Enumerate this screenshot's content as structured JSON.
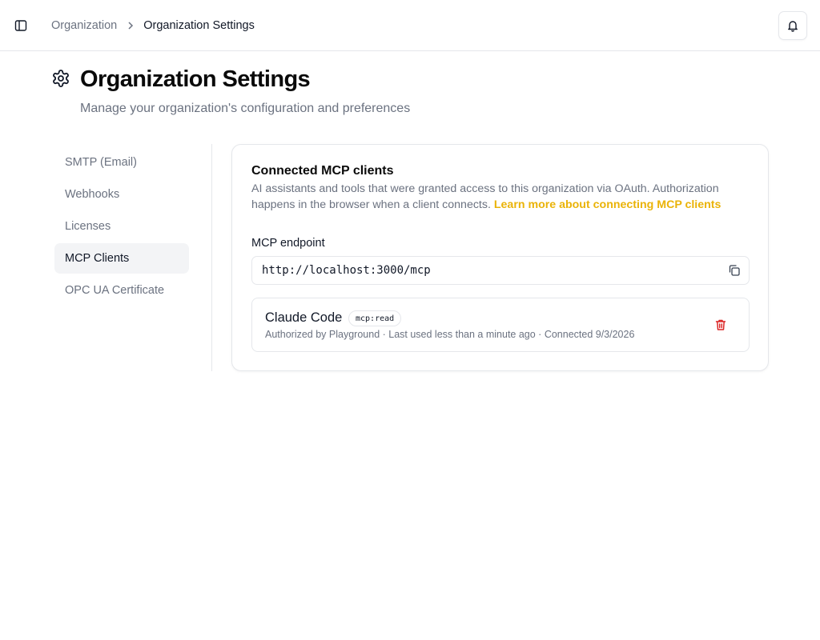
{
  "header": {
    "breadcrumb": {
      "parent": "Organization",
      "current": "Organization Settings"
    },
    "icons": {
      "sidebar_toggle": "sidebar-panel-icon",
      "separator": "chevron-right-icon",
      "notifications": "bell-icon"
    }
  },
  "page": {
    "title": "Organization Settings",
    "subtitle": "Manage your organization's configuration and preferences",
    "icon": "gear-icon"
  },
  "settings_nav": {
    "items": [
      {
        "label": "SMTP (Email)",
        "active": false
      },
      {
        "label": "Webhooks",
        "active": false
      },
      {
        "label": "Licenses",
        "active": false
      },
      {
        "label": "MCP Clients",
        "active": true
      },
      {
        "label": "OPC UA Certificate",
        "active": false
      }
    ]
  },
  "mcp_card": {
    "title": "Connected MCP clients",
    "description": "AI assistants and tools that were granted access to this organization via OAuth. Authorization happens in the browser when a client connects.",
    "learn_more": "Learn more about connecting MCP clients",
    "endpoint_label": "MCP endpoint",
    "endpoint_value": "http://localhost:3000/mcp",
    "clients": [
      {
        "name": "Claude Code",
        "scope": "mcp:read",
        "meta": "Authorized by Playground · Last used less than a minute ago · Connected 9/3/2026"
      }
    ]
  },
  "colors": {
    "accent_link": "#eab308",
    "danger": "#dc2626",
    "muted_text": "#6b7280",
    "border": "#e5e7eb",
    "active_nav_bg": "#f3f4f6"
  }
}
